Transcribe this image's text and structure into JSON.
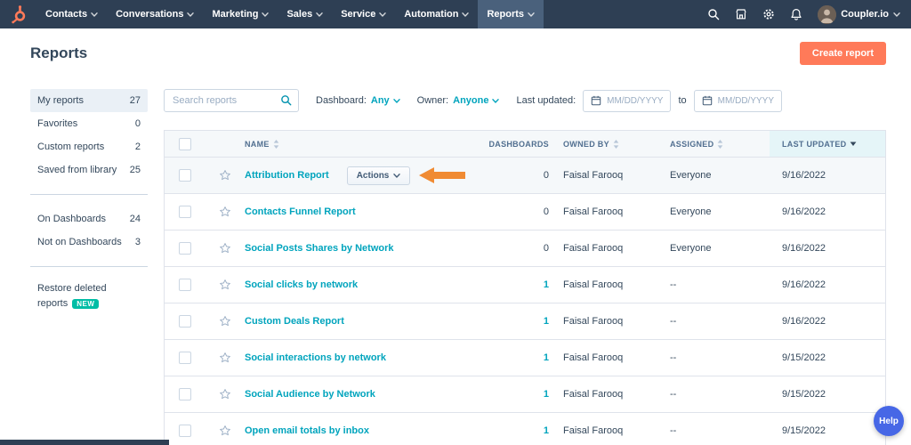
{
  "colors": {
    "navbar_bg": "#2e3f54",
    "brand_orange": "#ff7a59",
    "link_teal": "#00a4bd",
    "badge_teal": "#00bda5",
    "annotation_arrow_orange": "#f08b33",
    "help_button_blue": "#4767e6",
    "sorted_column_bg": "#e5f5f8"
  },
  "navbar": {
    "logo_icon": "hubspot-sprocket-logo",
    "items": [
      {
        "label": "Contacts",
        "active": false
      },
      {
        "label": "Conversations",
        "active": false
      },
      {
        "label": "Marketing",
        "active": false
      },
      {
        "label": "Sales",
        "active": false
      },
      {
        "label": "Service",
        "active": false
      },
      {
        "label": "Automation",
        "active": false
      },
      {
        "label": "Reports",
        "active": true
      }
    ],
    "right_icons": [
      "search-icon",
      "marketplace-icon",
      "settings-icon",
      "notifications-icon"
    ],
    "account_name": "Coupler.io"
  },
  "page_header": {
    "title": "Reports",
    "create_button_label": "Create report"
  },
  "sidebar": {
    "groups": [
      {
        "items": [
          {
            "label": "My reports",
            "count": "27",
            "active": true
          },
          {
            "label": "Favorites",
            "count": "0",
            "active": false
          },
          {
            "label": "Custom reports",
            "count": "2",
            "active": false
          },
          {
            "label": "Saved from library",
            "count": "25",
            "active": false
          }
        ]
      },
      {
        "items": [
          {
            "label": "On Dashboards",
            "count": "24",
            "active": false
          },
          {
            "label": "Not on Dashboards",
            "count": "3",
            "active": false
          }
        ]
      }
    ],
    "restore": {
      "label": "Restore deleted reports",
      "badge": "NEW"
    }
  },
  "filters": {
    "search_placeholder": "Search reports",
    "dashboard_label": "Dashboard:",
    "dashboard_value": "Any",
    "owner_label": "Owner:",
    "owner_value": "Anyone",
    "last_updated_label": "Last updated:",
    "date_from_placeholder": "MM/DD/YYYY",
    "to_label": "to",
    "date_to_placeholder": "MM/DD/YYYY"
  },
  "table": {
    "headers": {
      "name": "NAME",
      "dashboards": "DASHBOARDS",
      "owned_by": "OWNED BY",
      "assigned": "ASSIGNED",
      "last_updated": "LAST UPDATED"
    },
    "sorted_by": "LAST UPDATED",
    "sort_direction": "desc",
    "rows": [
      {
        "name": "Attribution Report",
        "actions_label": "Actions",
        "pointer_arrow": true,
        "highlighted": true,
        "dashboards": "0",
        "dashboards_link": false,
        "owned_by": "Faisal Farooq",
        "assigned": "Everyone",
        "last_updated": "9/16/2022"
      },
      {
        "name": "Contacts Funnel Report",
        "dashboards": "0",
        "dashboards_link": false,
        "owned_by": "Faisal Farooq",
        "assigned": "Everyone",
        "last_updated": "9/16/2022"
      },
      {
        "name": "Social Posts Shares by Network",
        "dashboards": "0",
        "dashboards_link": false,
        "owned_by": "Faisal Farooq",
        "assigned": "Everyone",
        "last_updated": "9/16/2022"
      },
      {
        "name": "Social clicks by network",
        "dashboards": "1",
        "dashboards_link": true,
        "owned_by": "Faisal Farooq",
        "assigned": "--",
        "last_updated": "9/16/2022"
      },
      {
        "name": "Custom Deals Report",
        "dashboards": "1",
        "dashboards_link": true,
        "owned_by": "Faisal Farooq",
        "assigned": "--",
        "last_updated": "9/16/2022"
      },
      {
        "name": "Social interactions by network",
        "dashboards": "1",
        "dashboards_link": true,
        "owned_by": "Faisal Farooq",
        "assigned": "--",
        "last_updated": "9/15/2022"
      },
      {
        "name": "Social Audience by Network",
        "dashboards": "1",
        "dashboards_link": true,
        "owned_by": "Faisal Farooq",
        "assigned": "--",
        "last_updated": "9/15/2022"
      },
      {
        "name": "Open email totals by inbox",
        "dashboards": "1",
        "dashboards_link": true,
        "owned_by": "Faisal Farooq",
        "assigned": "--",
        "last_updated": "9/15/2022"
      }
    ]
  },
  "help_button": {
    "label": "Help"
  }
}
